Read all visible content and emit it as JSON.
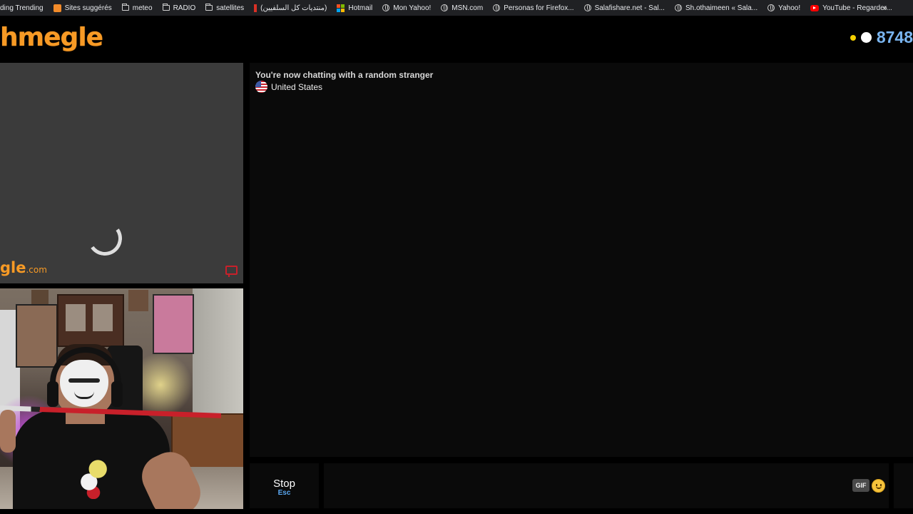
{
  "bookmarks": [
    {
      "label": "ding Trending",
      "icon": "none"
    },
    {
      "label": "Sites suggérés",
      "icon": "orange"
    },
    {
      "label": "meteo",
      "icon": "folder"
    },
    {
      "label": "RADIO",
      "icon": "folder"
    },
    {
      "label": "satellites",
      "icon": "folder"
    },
    {
      "label": "(منتديات كل السلفيين)",
      "icon": "redbar"
    },
    {
      "label": "Hotmail",
      "icon": "ms"
    },
    {
      "label": "Mon Yahoo!",
      "icon": "globe"
    },
    {
      "label": "MSN.com",
      "icon": "globe"
    },
    {
      "label": "Personas for Firefox...",
      "icon": "globe"
    },
    {
      "label": "Salafishare.net - Sal...",
      "icon": "globe"
    },
    {
      "label": "Sh.othaimeen « Sala...",
      "icon": "globe"
    },
    {
      "label": "Yahoo!",
      "icon": "globe"
    },
    {
      "label": "YouTube - Regarder...",
      "icon": "yt"
    }
  ],
  "bookmarks_more": "»",
  "header": {
    "logo": "hmegle",
    "online_count": "8748"
  },
  "stranger_video": {
    "watermark_main": "gle",
    "watermark_suffix": ".com"
  },
  "chat": {
    "status": "You're now chatting with a random stranger",
    "country": "United States"
  },
  "controls": {
    "stop_label": "Stop",
    "stop_key": "Esc",
    "message_placeholder": "",
    "gif_label": "GIF"
  },
  "colors": {
    "brand_orange": "#f79a25",
    "count_blue": "#7ab5f0",
    "esc_blue": "#5aa7f0"
  }
}
